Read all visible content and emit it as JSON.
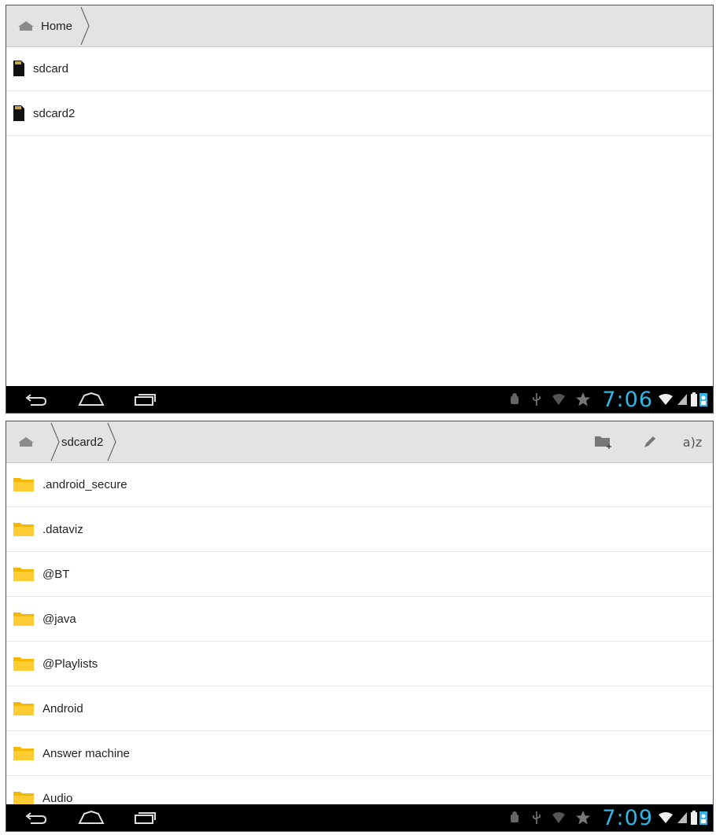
{
  "screen1": {
    "breadcrumb": {
      "home_label": "Home"
    },
    "items": [
      {
        "label": "sdcard",
        "icon": "sdcard-icon"
      },
      {
        "label": "sdcard2",
        "icon": "sdcard-icon"
      }
    ],
    "status": {
      "time": "7:06"
    }
  },
  "screen2": {
    "breadcrumb": {
      "current_label": "sdcard2"
    },
    "toolbar": {
      "sort_label": "a)z"
    },
    "items": [
      {
        "label": ".android_secure",
        "icon": "folder-icon"
      },
      {
        "label": ".dataviz",
        "icon": "folder-icon"
      },
      {
        "label": "@BT",
        "icon": "folder-icon"
      },
      {
        "label": "@java",
        "icon": "folder-icon"
      },
      {
        "label": "@Playlists",
        "icon": "folder-icon"
      },
      {
        "label": "Android",
        "icon": "folder-icon"
      },
      {
        "label": "Answer machine",
        "icon": "folder-icon"
      },
      {
        "label": "Audio",
        "icon": "folder-icon"
      }
    ],
    "status": {
      "time": "7:09"
    }
  },
  "colors": {
    "clock": "#33b5e5",
    "folder": "#f5b800",
    "actionbar": "#e3e3e3",
    "navbar": "#000000"
  }
}
